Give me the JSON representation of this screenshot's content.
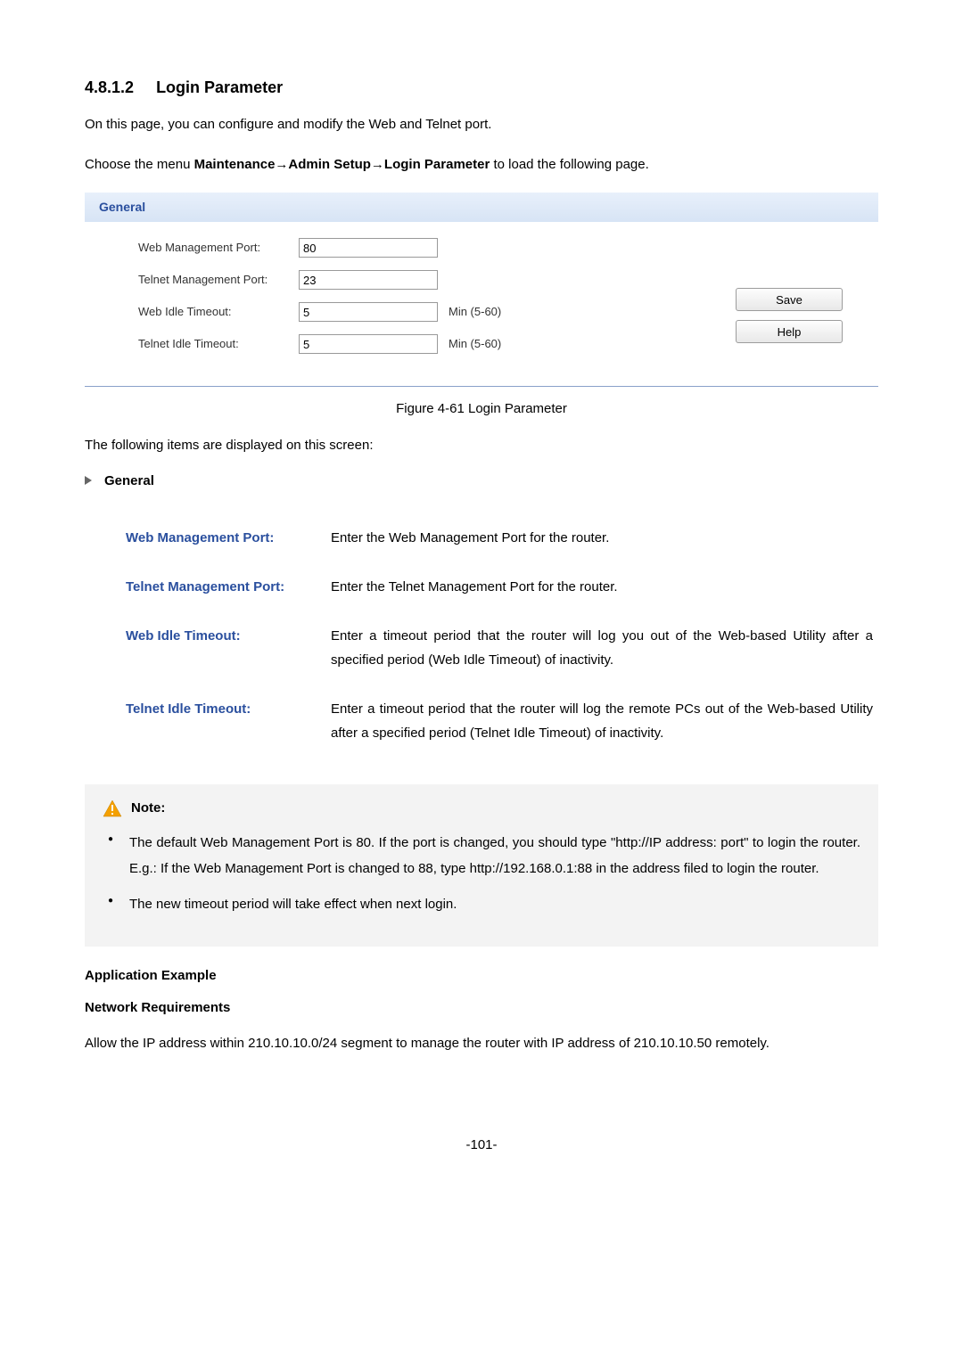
{
  "section": {
    "number": "4.8.1.2",
    "title": "Login Parameter"
  },
  "intro1": "On this page, you can configure and modify the Web and Telnet port.",
  "intro2_pre": "Choose the menu ",
  "intro2_bold": "Maintenance→Admin Setup→Login Parameter",
  "intro2_post": " to load the following page.",
  "panel": {
    "head": "General",
    "rows": {
      "webport": {
        "label": "Web Management Port:",
        "value": "80",
        "hint": ""
      },
      "telnetport": {
        "label": "Telnet Management Port:",
        "value": "23",
        "hint": ""
      },
      "webidle": {
        "label": "Web Idle Timeout:",
        "value": "5",
        "hint": "Min (5-60)"
      },
      "telnetidle": {
        "label": "Telnet Idle Timeout:",
        "value": "5",
        "hint": "Min (5-60)"
      }
    },
    "buttons": {
      "save": "Save",
      "help": "Help"
    }
  },
  "figcaption": "Figure 4-61 Login Parameter",
  "displayedline": "The following items are displayed on this screen:",
  "generalHeading": "General",
  "defs": {
    "webport": {
      "label": "Web Management Port:",
      "desc": "Enter the Web Management Port for the router."
    },
    "telnetport": {
      "label": "Telnet Management Port:",
      "desc": "Enter the Telnet Management Port for the router."
    },
    "webidle": {
      "label": "Web Idle Timeout:",
      "desc": "Enter a timeout period that the router will log you out of the Web-based Utility after a specified period (Web Idle Timeout) of inactivity."
    },
    "telnetidle": {
      "label": "Telnet Idle Timeout:",
      "desc": "Enter a timeout period that the router will log the remote PCs out of the Web-based Utility after a specified period (Telnet Idle Timeout) of inactivity."
    }
  },
  "note": {
    "heading": "Note:",
    "items": [
      "The default Web Management Port is 80. If the port is changed, you should type \"http://IP address: port\" to login the router. E.g.: If the Web Management Port is changed to 88, type http://192.168.0.1:88 in the address filed to login the router.",
      "The new timeout period will take effect when next login."
    ]
  },
  "appExample": "Application Example",
  "netReq": "Network Requirements",
  "reqPara": "Allow the IP address within 210.10.10.0/24 segment to manage the router with IP address of 210.10.10.50 remotely.",
  "pageNum": "-101-"
}
